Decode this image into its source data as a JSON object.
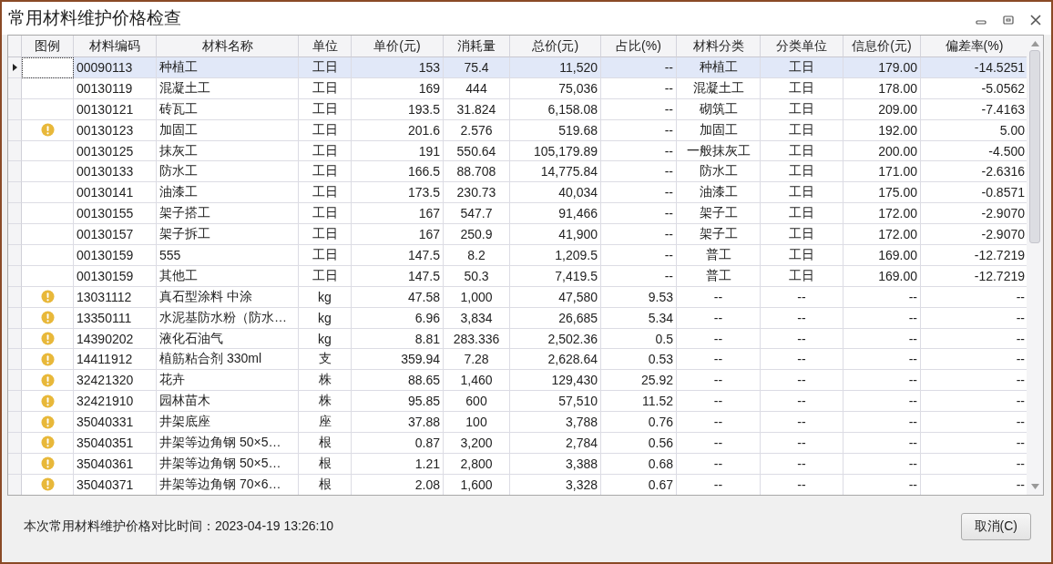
{
  "window": {
    "title": "常用材料维护价格检查"
  },
  "table": {
    "legend_column": "图例",
    "columns": [
      "材料编码",
      "材料名称",
      "单位",
      "单价(元)",
      "消耗量",
      "总价(元)",
      "占比(%)",
      "材料分类",
      "分类单位",
      "信息价(元)",
      "偏差率(%)"
    ],
    "rows": [
      {
        "selected": true,
        "warning": false,
        "cells": [
          "00090113",
          "种植工",
          "工日",
          "153",
          "75.4",
          "11,520",
          "--",
          "种植工",
          "工日",
          "179.00",
          "-14.5251"
        ]
      },
      {
        "selected": false,
        "warning": false,
        "cells": [
          "00130119",
          "混凝土工",
          "工日",
          "169",
          "444",
          "75,036",
          "--",
          "混凝土工",
          "工日",
          "178.00",
          "-5.0562"
        ]
      },
      {
        "selected": false,
        "warning": false,
        "cells": [
          "00130121",
          "砖瓦工",
          "工日",
          "193.5",
          "31.824",
          "6,158.08",
          "--",
          "砌筑工",
          "工日",
          "209.00",
          "-7.4163"
        ]
      },
      {
        "selected": false,
        "warning": true,
        "cells": [
          "00130123",
          "加固工",
          "工日",
          "201.6",
          "2.576",
          "519.68",
          "--",
          "加固工",
          "工日",
          "192.00",
          "5.00"
        ]
      },
      {
        "selected": false,
        "warning": false,
        "cells": [
          "00130125",
          "抹灰工",
          "工日",
          "191",
          "550.64",
          "105,179.89",
          "--",
          "一般抹灰工",
          "工日",
          "200.00",
          "-4.500"
        ]
      },
      {
        "selected": false,
        "warning": false,
        "cells": [
          "00130133",
          "防水工",
          "工日",
          "166.5",
          "88.708",
          "14,775.84",
          "--",
          "防水工",
          "工日",
          "171.00",
          "-2.6316"
        ]
      },
      {
        "selected": false,
        "warning": false,
        "cells": [
          "00130141",
          "油漆工",
          "工日",
          "173.5",
          "230.73",
          "40,034",
          "--",
          "油漆工",
          "工日",
          "175.00",
          "-0.8571"
        ]
      },
      {
        "selected": false,
        "warning": false,
        "cells": [
          "00130155",
          "架子搭工",
          "工日",
          "167",
          "547.7",
          "91,466",
          "--",
          "架子工",
          "工日",
          "172.00",
          "-2.9070"
        ]
      },
      {
        "selected": false,
        "warning": false,
        "cells": [
          "00130157",
          "架子拆工",
          "工日",
          "167",
          "250.9",
          "41,900",
          "--",
          "架子工",
          "工日",
          "172.00",
          "-2.9070"
        ]
      },
      {
        "selected": false,
        "warning": false,
        "cells": [
          "00130159",
          "555",
          "工日",
          "147.5",
          "8.2",
          "1,209.5",
          "--",
          "普工",
          "工日",
          "169.00",
          "-12.7219"
        ]
      },
      {
        "selected": false,
        "warning": false,
        "cells": [
          "00130159",
          "其他工",
          "工日",
          "147.5",
          "50.3",
          "7,419.5",
          "--",
          "普工",
          "工日",
          "169.00",
          "-12.7219"
        ]
      },
      {
        "selected": false,
        "warning": true,
        "cells": [
          "13031112",
          "真石型涂料 中涂",
          "kg",
          "47.58",
          "1,000",
          "47,580",
          "9.53",
          "--",
          "--",
          "--",
          "--"
        ]
      },
      {
        "selected": false,
        "warning": true,
        "cells": [
          "13350111",
          "水泥基防水粉（防水…",
          "kg",
          "6.96",
          "3,834",
          "26,685",
          "5.34",
          "--",
          "--",
          "--",
          "--"
        ]
      },
      {
        "selected": false,
        "warning": true,
        "cells": [
          "14390202",
          "液化石油气",
          "kg",
          "8.81",
          "283.336",
          "2,502.36",
          "0.5",
          "--",
          "--",
          "--",
          "--"
        ]
      },
      {
        "selected": false,
        "warning": true,
        "cells": [
          "14411912",
          "植筋粘合剂 330ml",
          "支",
          "359.94",
          "7.28",
          "2,628.64",
          "0.53",
          "--",
          "--",
          "--",
          "--"
        ]
      },
      {
        "selected": false,
        "warning": true,
        "cells": [
          "32421320",
          "花卉",
          "株",
          "88.65",
          "1,460",
          "129,430",
          "25.92",
          "--",
          "--",
          "--",
          "--"
        ]
      },
      {
        "selected": false,
        "warning": true,
        "cells": [
          "32421910",
          "园林苗木",
          "株",
          "95.85",
          "600",
          "57,510",
          "11.52",
          "--",
          "--",
          "--",
          "--"
        ]
      },
      {
        "selected": false,
        "warning": true,
        "cells": [
          "35040331",
          "井架底座",
          "座",
          "37.88",
          "100",
          "3,788",
          "0.76",
          "--",
          "--",
          "--",
          "--"
        ]
      },
      {
        "selected": false,
        "warning": true,
        "cells": [
          "35040351",
          "井架等边角钢 50×5…",
          "根",
          "0.87",
          "3,200",
          "2,784",
          "0.56",
          "--",
          "--",
          "--",
          "--"
        ]
      },
      {
        "selected": false,
        "warning": true,
        "cells": [
          "35040361",
          "井架等边角钢 50×5…",
          "根",
          "1.21",
          "2,800",
          "3,388",
          "0.68",
          "--",
          "--",
          "--",
          "--"
        ]
      },
      {
        "selected": false,
        "warning": true,
        "cells": [
          "35040371",
          "井架等边角钢 70×6…",
          "根",
          "2.08",
          "1,600",
          "3,328",
          "0.67",
          "--",
          "--",
          "--",
          "--"
        ]
      }
    ]
  },
  "footer": {
    "compare_time": "本次常用材料维护价格对比时间：2023-04-19 13:26:10",
    "cancel_button": "取消(C)"
  }
}
